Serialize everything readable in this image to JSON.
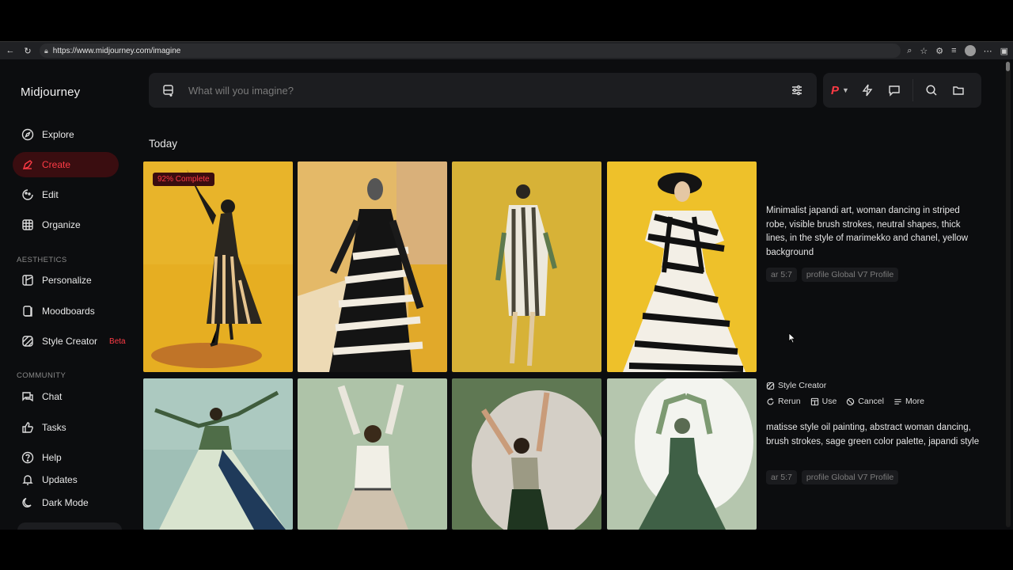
{
  "browser": {
    "url": "https://www.midjourney.com/imagine"
  },
  "app": {
    "logo": "Midjourney"
  },
  "sidebar": {
    "items": [
      {
        "label": "Explore"
      },
      {
        "label": "Create"
      },
      {
        "label": "Edit"
      },
      {
        "label": "Organize"
      }
    ],
    "aesthetics_label": "AESTHETICS",
    "aesthetics_items": [
      {
        "label": "Personalize"
      },
      {
        "label": "Moodboards"
      },
      {
        "label": "Style Creator",
        "badge": "Beta"
      }
    ],
    "community_label": "COMMUNITY",
    "community_items": [
      {
        "label": "Chat"
      },
      {
        "label": "Tasks"
      }
    ],
    "footer_items": [
      {
        "label": "Help"
      },
      {
        "label": "Updates"
      },
      {
        "label": "Dark Mode"
      }
    ]
  },
  "prompt": {
    "placeholder": "What will you imagine?"
  },
  "toolbar": {
    "profile_letter": "P"
  },
  "feed": {
    "section_title": "Today",
    "jobs": [
      {
        "progress_label": "92% Complete",
        "progress": 0.92,
        "prompt": "Minimalist japandi art, woman dancing in striped robe, visible brush strokes, neutral shapes, thick lines, in the style of marimekko and chanel, yellow background",
        "tags": [
          "ar 5:7",
          "profile Global V7 Profile"
        ],
        "style_creator_label": "Style Creator",
        "actions": [
          "Rerun",
          "Use",
          "Cancel",
          "More"
        ]
      },
      {
        "prompt": "matisse style oil painting, abstract woman dancing, brush strokes, sage green color palette, japandi style",
        "tags": [
          "ar 5:7",
          "profile Global V7 Profile"
        ]
      }
    ]
  },
  "colors": {
    "accent": "#ff3b45",
    "background": "#0c0d0f",
    "panel": "#1c1d20"
  }
}
